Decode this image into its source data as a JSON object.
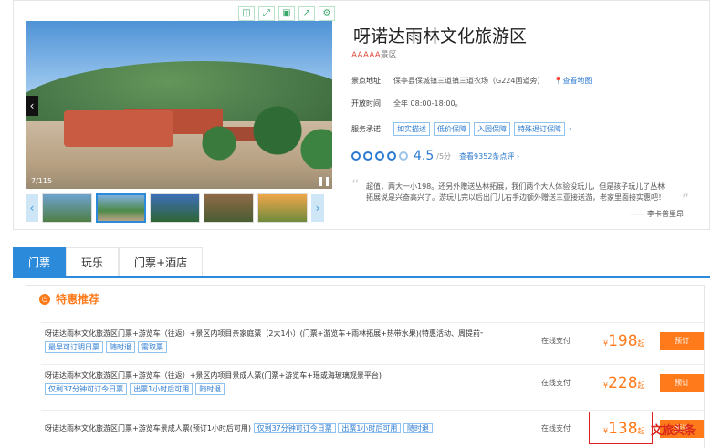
{
  "toolbar": {
    "icons": [
      "capture-icon",
      "expand-icon",
      "save-icon",
      "share-icon",
      "settings-icon"
    ]
  },
  "gallery": {
    "counter": "7/115"
  },
  "attraction": {
    "title": "呀诺达雨林文化旅游区",
    "grade": "AAAAA",
    "grade_suffix": "景区",
    "address_label": "景点地址",
    "address": "保亭县保城镇三道镇三道农场（G224国道旁）",
    "map_link": "查看地图",
    "hours_label": "开放时间",
    "hours": "全年 08:00-18:00。",
    "promise_label": "服务承诺",
    "promises": [
      "如实描述",
      "低价保障",
      "入园保障",
      "特殊退订保障"
    ],
    "score": "4.5",
    "score_suffix": "/5分",
    "review_link": "查看9352条点评"
  },
  "review": {
    "text": "超值，两大一小198。还另外赠送丛林拓展，我们两个大人体验没玩儿，但是孩子玩儿了丛林拓展说是兴奋高兴了。游玩儿完以后出门儿右手边额外赠送三亚接送游，老家里面接实惠吧！",
    "author": "李卡普里昂"
  },
  "tabs": [
    "门票",
    "玩乐",
    "门票+酒店"
  ],
  "deals": {
    "title": "特惠推荐",
    "rows": [
      {
        "name": "呀诺达雨林文化旅游区门票+游览车（往返）+景区内项目亲家庭票（2大1小）(门票+游览车+雨林拓展+热带水果)(特惠活动、周提前一天预订)",
        "tags": [
          "最早可订明日票",
          "随时退",
          "需取票"
        ],
        "pay": "在线支付",
        "currency": "¥",
        "price": "198",
        "qi": "起",
        "btn": "预订"
      },
      {
        "name": "呀诺达雨林文化旅游区门票+游览车（往返）+景区内项目景成人票(门票+游览车+瑶或海玻璃观景平台)",
        "tags": [
          "仅剩37分钟可订今日票",
          "出票1小时后可用",
          "随时退"
        ],
        "pay": "在线支付",
        "currency": "¥",
        "price": "228",
        "qi": "起",
        "btn": "预订"
      },
      {
        "name": "呀诺达雨林文化旅游区门票+游览车景成人票(预订1小时后可用)",
        "tags": [
          "仅剩37分钟可订今日票",
          "出票1小时后可用",
          "随时退"
        ],
        "pay": "在线支付",
        "currency": "¥",
        "price": "138",
        "qi": "起",
        "btn": "预订"
      }
    ]
  },
  "watermark": "文旅头条"
}
